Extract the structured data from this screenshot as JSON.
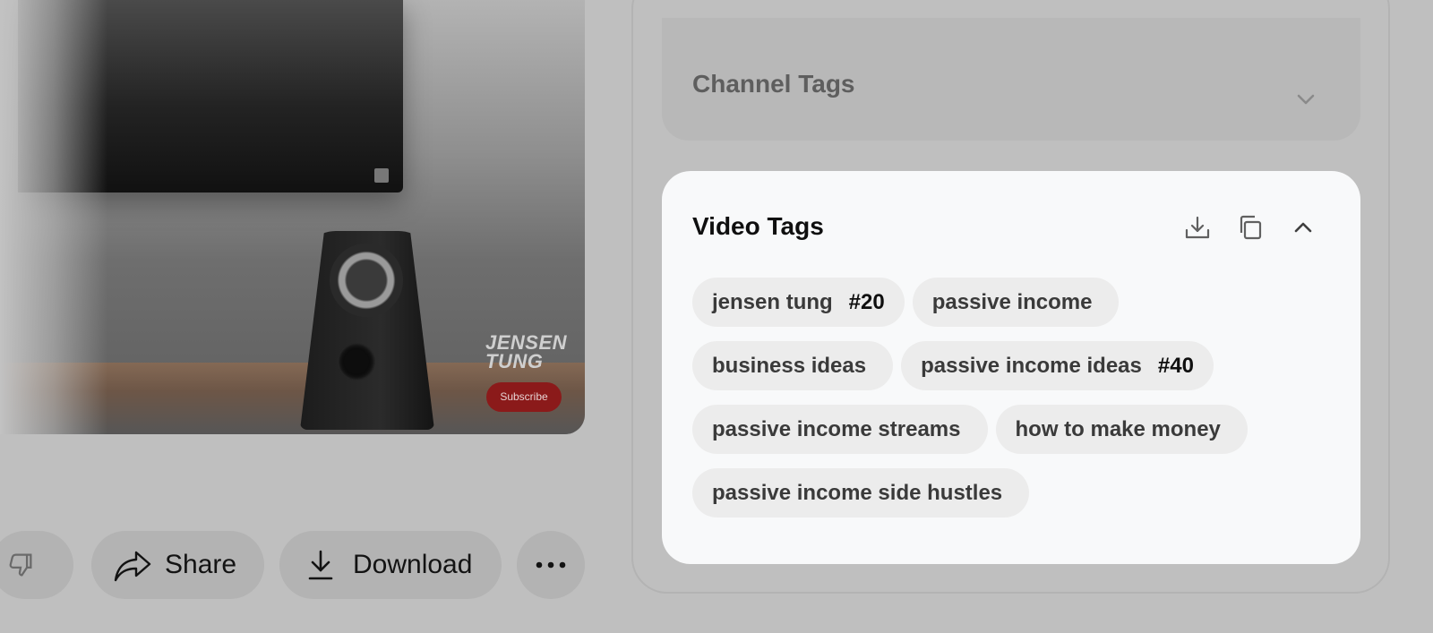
{
  "video": {
    "brand_line1": "JENSEN",
    "brand_line2": "TUNG",
    "subscribe_label": "Subscribe"
  },
  "actions": {
    "share_label": "Share",
    "download_label": "Download"
  },
  "channel_tags": {
    "title": "Channel Tags"
  },
  "video_tags": {
    "title": "Video Tags",
    "tags": [
      {
        "text": "jensen tung",
        "rank": "#20"
      },
      {
        "text": "passive income",
        "rank": ""
      },
      {
        "text": "business ideas",
        "rank": ""
      },
      {
        "text": "passive income ideas",
        "rank": "#40"
      },
      {
        "text": "passive income streams",
        "rank": ""
      },
      {
        "text": "how to make money",
        "rank": ""
      },
      {
        "text": "passive income side hustles",
        "rank": ""
      }
    ]
  },
  "icons": {
    "download_tags": "download-icon",
    "copy_tags": "copy-icon",
    "collapse": "chevron-up-icon",
    "expand": "chevron-down-icon",
    "share": "share-arrow-icon",
    "download": "download-icon",
    "more": "more-horizontal-icon",
    "dislike": "thumbs-down-icon"
  }
}
